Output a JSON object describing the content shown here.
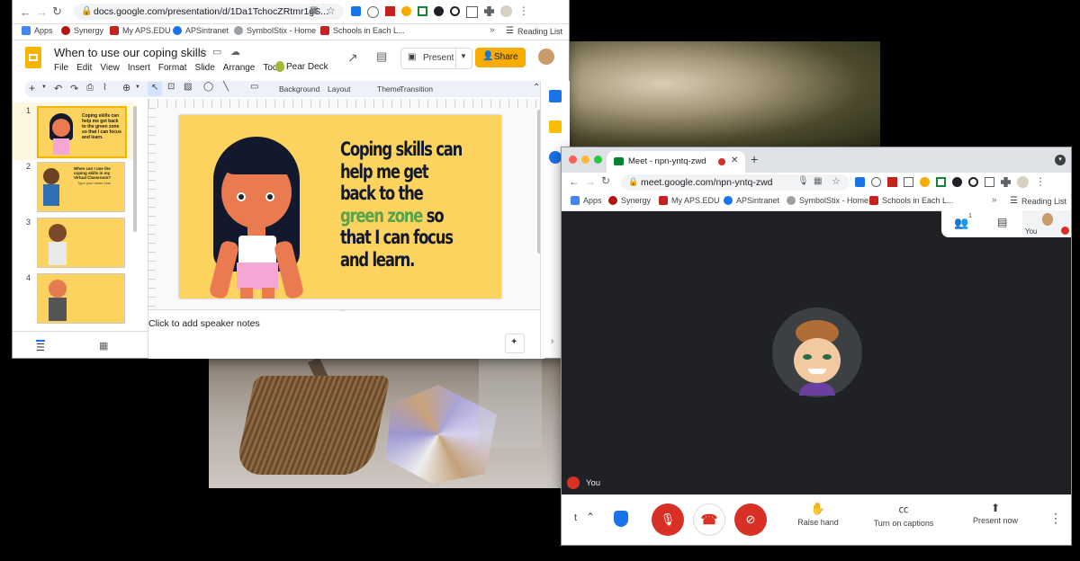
{
  "slides_window": {
    "url": "docs.google.com/presentation/d/1Da1TchocZRtmr1gS...",
    "bookmarks": [
      "Apps",
      "Synergy",
      "My APS.EDU",
      "APSintranet",
      "SymbolStix - Home",
      "Schools in Each L..."
    ],
    "reading_list": "Reading List",
    "doc_title": "When to use our coping skills",
    "menu": [
      "File",
      "Edit",
      "View",
      "Insert",
      "Format",
      "Slide",
      "Arrange",
      "Tools"
    ],
    "pear_deck": "Pear Deck",
    "present_label": "Present",
    "share_label": "Share",
    "toolbar": {
      "background": "Background",
      "layout": "Layout",
      "theme": "Theme",
      "transition": "Transition",
      "plus": "+"
    },
    "slide_numbers": [
      "1",
      "2",
      "3",
      "4"
    ],
    "thumb1_text": "Coping skills can help me get back to the green zone so that I can focus and learn.",
    "thumb2_text": "When can I use the coping skills in my Virtual Classroom?",
    "thumb2_bullet": "Type your ideas here",
    "slide": {
      "line1": "Coping skills can",
      "line2": "help me get",
      "line3": "back to the",
      "green": "green zone",
      "so": " so",
      "line5": "that I can focus",
      "line6": "and learn."
    },
    "speaker_notes": "Click to add speaker notes",
    "colors": {
      "slide_bg": "#fbd35e",
      "green": "#5aa34a",
      "share": "#f9ab00"
    }
  },
  "meet_window": {
    "tab_title": "Meet - npn-yntq-zwd",
    "url": "meet.google.com/npn-yntq-zwd",
    "bookmarks": [
      "Apps",
      "Synergy",
      "My APS.EDU",
      "APSintranet",
      "SymbolStix - Home",
      "Schools in Each L..."
    ],
    "reading_list": "Reading List",
    "you_label": "You",
    "self_tile_label": "You",
    "people_count": "1",
    "raise_hand": "Raise hand",
    "captions": "Turn on captions",
    "present_now": "Present now",
    "meeting_code_fragment": "t",
    "colors": {
      "red": "#d93025",
      "bg": "#202124"
    }
  }
}
